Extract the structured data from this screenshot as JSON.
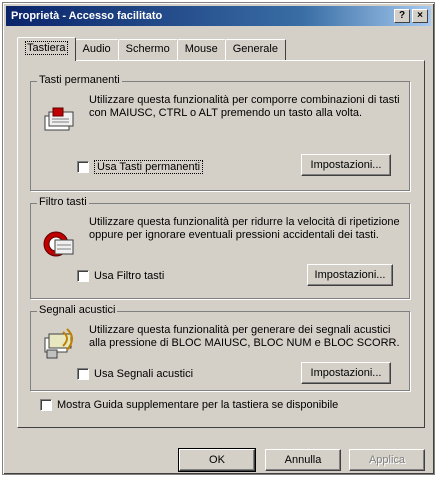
{
  "window": {
    "title": "Proprietà - Accesso facilitato",
    "help_button": "?",
    "close_button": "×"
  },
  "tabs": [
    {
      "label": "Tastiera"
    },
    {
      "label": "Audio"
    },
    {
      "label": "Schermo"
    },
    {
      "label": "Mouse"
    },
    {
      "label": "Generale"
    }
  ],
  "groups": {
    "sticky": {
      "legend": "Tasti permanenti",
      "description": "Utilizzare questa funzionalità per comporre combinazioni di tasti con MAIUSC, CTRL o ALT premendo un tasto alla volta.",
      "checkbox_label": "Usa Tasti permanenti",
      "settings_label": "Impostazioni..."
    },
    "filter": {
      "legend": "Filtro tasti",
      "description": "Utilizzare questa funzionalità per ridurre la velocità di ripetizione oppure per ignorare eventuali pressioni accidentali dei tasti.",
      "checkbox_label": "Usa Filtro tasti",
      "settings_label": "Impostazioni..."
    },
    "toggle": {
      "legend": "Segnali acustici",
      "description": "Utilizzare questa funzionalità per generare dei segnali acustici alla pressione di BLOC MAIUSC, BLOC NUM e BLOC SCORR.",
      "checkbox_label": "Usa Segnali acustici",
      "settings_label": "Impostazioni..."
    }
  },
  "extra_help": {
    "checkbox_label": "Mostra Guida supplementare per la tastiera se disponibile"
  },
  "footer": {
    "ok_label": "OK",
    "cancel_label": "Annulla",
    "apply_label": "Applica"
  },
  "colors": {
    "face": "#d4d0c8",
    "title_start": "#0a246a",
    "title_end": "#a6caf0"
  }
}
